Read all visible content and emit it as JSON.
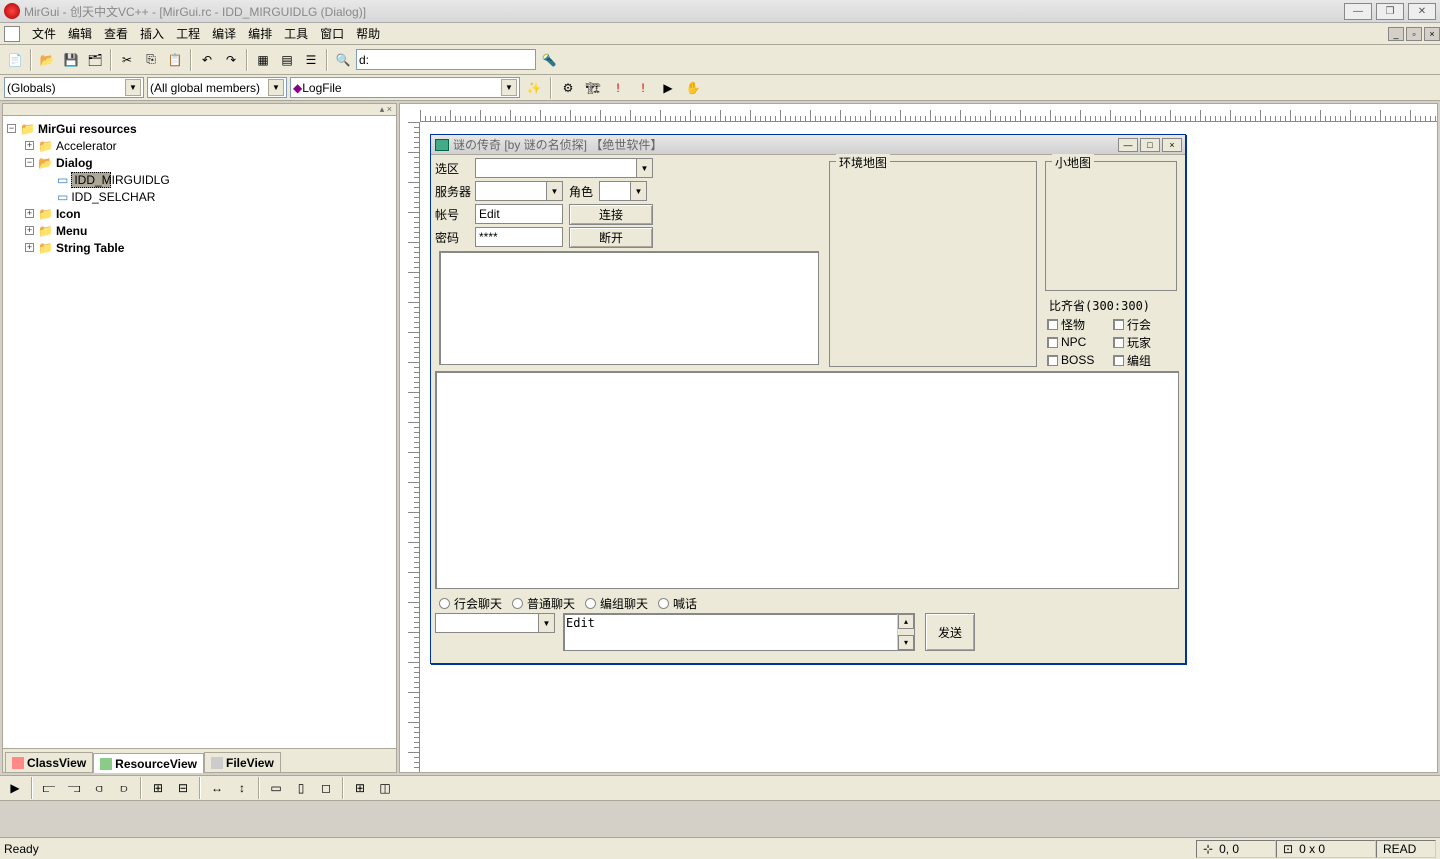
{
  "window": {
    "title": "MirGui - 创天中文VC++ - [MirGui.rc - IDD_MIRGUIDLG (Dialog)]"
  },
  "menu": [
    "文件",
    "编辑",
    "查看",
    "插入",
    "工程",
    "编译",
    "编排",
    "工具",
    "窗口",
    "帮助"
  ],
  "path_combo": "d:",
  "combos": {
    "scope": "(Globals)",
    "members": "(All global members)",
    "func": "LogFile"
  },
  "tree": {
    "root": "MirGui resources",
    "items": [
      {
        "label": "Accelerator",
        "children": true
      },
      {
        "label": "Dialog",
        "children": true,
        "open": true,
        "sub": [
          {
            "label": "IDD_MIRGUIDLG",
            "selected": true
          },
          {
            "label": "IDD_SELCHAR"
          }
        ]
      },
      {
        "label": "Icon",
        "children": true
      },
      {
        "label": "Menu",
        "children": true
      },
      {
        "label": "String Table",
        "children": true
      }
    ]
  },
  "tabs": [
    "ClassView",
    "ResourceView",
    "FileView"
  ],
  "active_tab": 1,
  "dialog": {
    "title": "谜の传奇 [by 谜の名侦探] 【绝世软件】",
    "labels": {
      "zone": "选区",
      "server": "服务器",
      "role": "角色",
      "account": "帐号",
      "password": "密码",
      "connect": "连接",
      "disconnect": "断开",
      "envmap": "环境地图",
      "minimap": "小地图",
      "loc": "比齐省(300:300)",
      "checks": [
        "怪物",
        "行会",
        "NPC",
        "玩家",
        "BOSS",
        "编组"
      ],
      "radios": [
        "行会聊天",
        "普通聊天",
        "编组聊天",
        "喊话"
      ],
      "send": "发送"
    },
    "account_value": "Edit",
    "password_value": "****",
    "chat_value": "Edit"
  },
  "status": {
    "ready": "Ready",
    "pos": "0, 0",
    "size": "0 x 0",
    "read": "READ"
  }
}
